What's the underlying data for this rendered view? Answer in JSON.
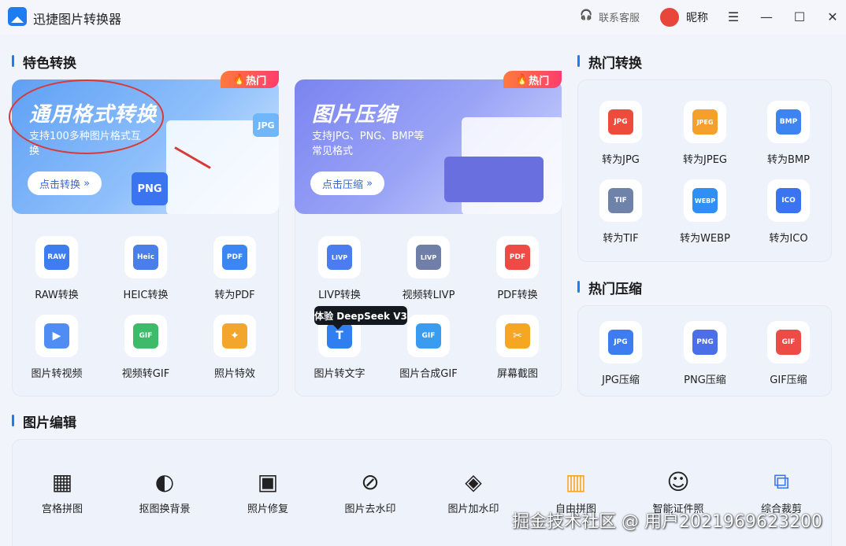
{
  "window": {
    "title": "迅捷图片转换器",
    "support": "联系客服",
    "nickname": "昵称"
  },
  "sections": {
    "featured": "特色转换",
    "hot_convert": "热门转换",
    "hot_compress": "热门压缩",
    "edit": "图片编辑"
  },
  "banners": [
    {
      "title": "通用格式转换",
      "subtitle": "支持100多种图片格式互换",
      "button": "点击转换",
      "badge": "热门",
      "color": "#5fa0f5"
    },
    {
      "title": "图片压缩",
      "subtitle": "支持JPG、PNG、BMP等常见格式",
      "button": "点击压缩",
      "badge": "热门",
      "color": "#7a84f0"
    }
  ],
  "left_tools": [
    {
      "label": "RAW转换",
      "icon": "raw-icon",
      "glyph": "RAW",
      "color": "#3d7df0"
    },
    {
      "label": "HEIC转换",
      "icon": "heic-icon",
      "glyph": "Heic",
      "color": "#4a7ee8"
    },
    {
      "label": "转为PDF",
      "icon": "to-pdf-icon",
      "glyph": "PDF",
      "color": "#3a86f2"
    },
    {
      "label": "图片转视频",
      "icon": "image-to-video-icon",
      "glyph": "▶",
      "color": "#4f8df5"
    },
    {
      "label": "视频转GIF",
      "icon": "video-to-gif-icon",
      "glyph": "GIF",
      "color": "#3dbb6a"
    },
    {
      "label": "照片特效",
      "icon": "photo-effect-icon",
      "glyph": "✦",
      "color": "#f2a62c"
    }
  ],
  "right_tools": [
    {
      "label": "LIVP转换",
      "icon": "livp-icon",
      "glyph": "LIVP",
      "color": "#4a7ef0"
    },
    {
      "label": "视频转LIVP",
      "icon": "video-to-livp-icon",
      "glyph": "LIVP",
      "color": "#6f7fa8"
    },
    {
      "label": "PDF转换",
      "icon": "pdf-convert-icon",
      "glyph": "PDF",
      "color": "#ef4b46"
    },
    {
      "label": "图片转文字",
      "icon": "image-to-text-icon",
      "glyph": "T",
      "color": "#2f7ff0"
    },
    {
      "label": "图片合成GIF",
      "icon": "merge-gif-icon",
      "glyph": "GIF",
      "color": "#3a9cf0"
    },
    {
      "label": "屏幕截图",
      "icon": "screenshot-icon",
      "glyph": "✂",
      "color": "#f5a623"
    }
  ],
  "deepseek_badge": "体验 DeepSeek V3",
  "hot_convert": [
    {
      "label": "转为JPG",
      "icon": "jpg-icon",
      "glyph": "JPG",
      "color": "#ef4b3c"
    },
    {
      "label": "转为JPEG",
      "icon": "jpeg-icon",
      "glyph": "JPEG",
      "color": "#f5a02a"
    },
    {
      "label": "转为BMP",
      "icon": "bmp-icon",
      "glyph": "BMP",
      "color": "#3d84f2"
    },
    {
      "label": "转为TIF",
      "icon": "tif-icon",
      "glyph": "TIF",
      "color": "#6f82a8"
    },
    {
      "label": "转为WEBP",
      "icon": "webp-icon",
      "glyph": "WEBP",
      "color": "#2f8ff5"
    },
    {
      "label": "转为ICO",
      "icon": "ico-icon",
      "glyph": "ICO",
      "color": "#3a74f0"
    }
  ],
  "hot_compress": [
    {
      "label": "JPG压缩",
      "icon": "jpg-compress-icon",
      "glyph": "JPG",
      "color": "#3d7df0"
    },
    {
      "label": "PNG压缩",
      "icon": "png-compress-icon",
      "glyph": "PNG",
      "color": "#4a6fe8"
    },
    {
      "label": "GIF压缩",
      "icon": "gif-compress-icon",
      "glyph": "GIF",
      "color": "#ef4b46"
    }
  ],
  "edit_tools": [
    {
      "label": "宫格拼图",
      "icon": "grid-puzzle-icon",
      "glyph": "▦"
    },
    {
      "label": "抠图换背景",
      "icon": "cutout-icon",
      "glyph": "◐"
    },
    {
      "label": "照片修复",
      "icon": "photo-repair-icon",
      "glyph": "▣"
    },
    {
      "label": "图片去水印",
      "icon": "remove-watermark-icon",
      "glyph": "⊘"
    },
    {
      "label": "图片加水印",
      "icon": "add-watermark-icon",
      "glyph": "◈"
    },
    {
      "label": "自由拼图",
      "icon": "free-puzzle-icon",
      "glyph": "▥"
    },
    {
      "label": "智能证件照",
      "icon": "id-photo-icon",
      "glyph": "☺"
    },
    {
      "label": "综合裁剪",
      "icon": "crop-icon",
      "glyph": "⧉"
    }
  ],
  "watermark": "掘金技术社区 @ 用户2021969623200"
}
